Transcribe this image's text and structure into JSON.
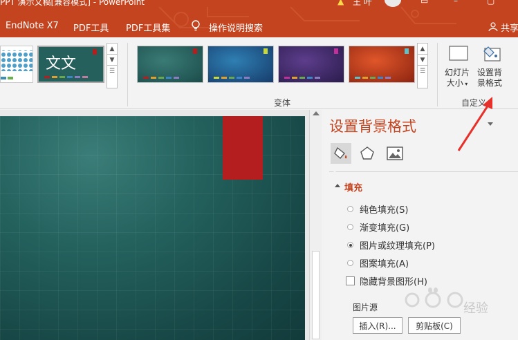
{
  "window": {
    "title": "PPT 演示文稿[兼容模式] - PowerPoint",
    "user": "王 叶"
  },
  "tabs": [
    {
      "label": "EndNote X7"
    },
    {
      "label": "PDF工具"
    },
    {
      "label": "PDF工具集"
    },
    {
      "label": "操作说明搜索"
    }
  ],
  "share_label": "共享",
  "ribbon": {
    "theme_text": "文文",
    "variant_group_label": "变体",
    "slide_size_label_line1": "幻灯片",
    "slide_size_label_line2": "大小",
    "format_bg_label_line1": "设置背",
    "format_bg_label_line2": "景格式",
    "customize_group_label": "自定义"
  },
  "pane": {
    "title": "设置背景格式",
    "section": "填充",
    "options": [
      {
        "label": "纯色填充(S)",
        "selected": false
      },
      {
        "label": "渐变填充(G)",
        "selected": false
      },
      {
        "label": "图片或纹理填充(P)",
        "selected": true
      },
      {
        "label": "图案填充(A)",
        "selected": false
      }
    ],
    "hide_bg_graphics": "隐藏背景图形(H)",
    "picture_source": "图片源",
    "insert_button": "插入(R)...",
    "clipboard_button": "剪贴板(C)"
  },
  "watermark": {
    "text": "经验"
  },
  "colors": {
    "accent": "#c4441f",
    "slide_bg": "#24625e",
    "red_tab": "#b51e1e"
  }
}
